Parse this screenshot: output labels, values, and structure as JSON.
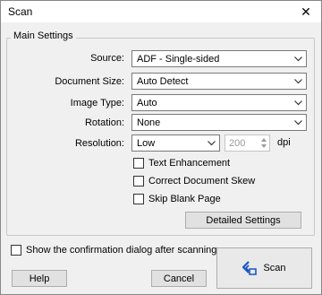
{
  "window": {
    "title": "Scan"
  },
  "main_settings": {
    "group_label": "Main Settings",
    "source": {
      "label": "Source:",
      "value": "ADF - Single-sided"
    },
    "document_size": {
      "label": "Document Size:",
      "value": "Auto Detect"
    },
    "image_type": {
      "label": "Image Type:",
      "value": "Auto"
    },
    "rotation": {
      "label": "Rotation:",
      "value": "None"
    },
    "resolution": {
      "label": "Resolution:",
      "value": "Low",
      "dpi_value": "200",
      "unit": "dpi"
    },
    "text_enhancement": {
      "label": "Text Enhancement",
      "checked": false
    },
    "correct_skew": {
      "label": "Correct Document Skew",
      "checked": false
    },
    "skip_blank": {
      "label": "Skip Blank Page",
      "checked": false
    },
    "detailed_settings_label": "Detailed Settings"
  },
  "footer": {
    "show_confirmation": {
      "label": "Show the confirmation dialog after scanning",
      "checked": false
    },
    "help_label": "Help",
    "cancel_label": "Cancel",
    "scan_label": "Scan"
  }
}
